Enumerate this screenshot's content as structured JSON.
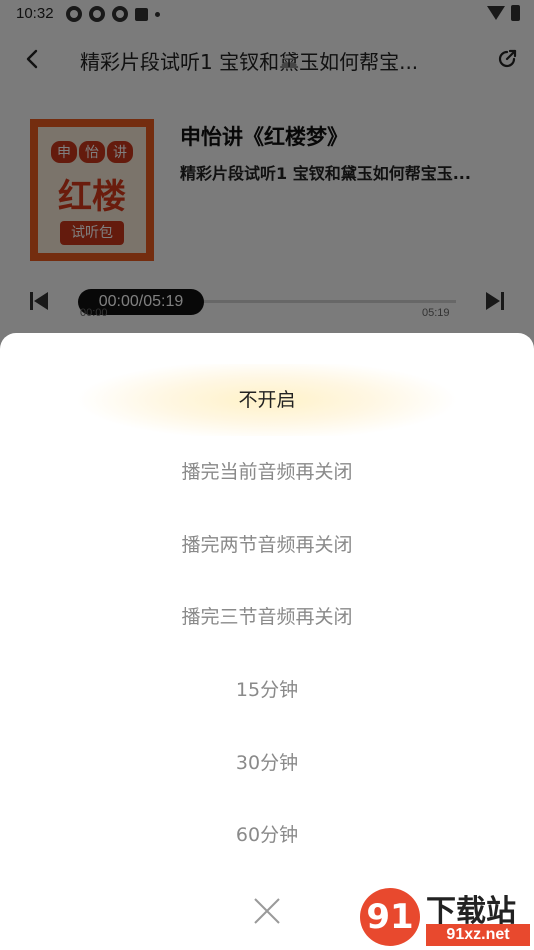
{
  "status_bar": {
    "time": "10:32",
    "icons": [
      "app-icon",
      "app-icon",
      "app-icon",
      "a-icon",
      "dot-icon"
    ],
    "right_icons": [
      "wifi-icon",
      "battery-icon"
    ]
  },
  "header": {
    "title": "精彩片段试听1 宝钗和黛玉如何帮宝..."
  },
  "album": {
    "cover_text_top": [
      "申",
      "怡",
      "讲"
    ],
    "cover_text_main": "红楼",
    "cover_text_badge": "试听包",
    "title": "申怡讲《红楼梦》",
    "episode": "精彩片段试听1 宝钗和黛玉如何帮宝玉..."
  },
  "player": {
    "current_time_pill": "00:00/05:19",
    "current_time": "00:00",
    "duration": "05:19",
    "progress": 0.0
  },
  "sheet": {
    "options": [
      {
        "label": "不开启",
        "selected": true
      },
      {
        "label": "播完当前音频再关闭",
        "selected": false
      },
      {
        "label": "播完两节音频再关闭",
        "selected": false
      },
      {
        "label": "播完三节音频再关闭",
        "selected": false
      },
      {
        "label": "15分钟",
        "selected": false
      },
      {
        "label": "30分钟",
        "selected": false
      },
      {
        "label": "60分钟",
        "selected": false
      }
    ]
  },
  "watermark": {
    "logo": "91",
    "text": "下载站",
    "site": "91xz.net"
  },
  "colors": {
    "accent": "#e85a1e",
    "selected_glow": "#fff2c8",
    "option_text": "#8a8a8a"
  }
}
